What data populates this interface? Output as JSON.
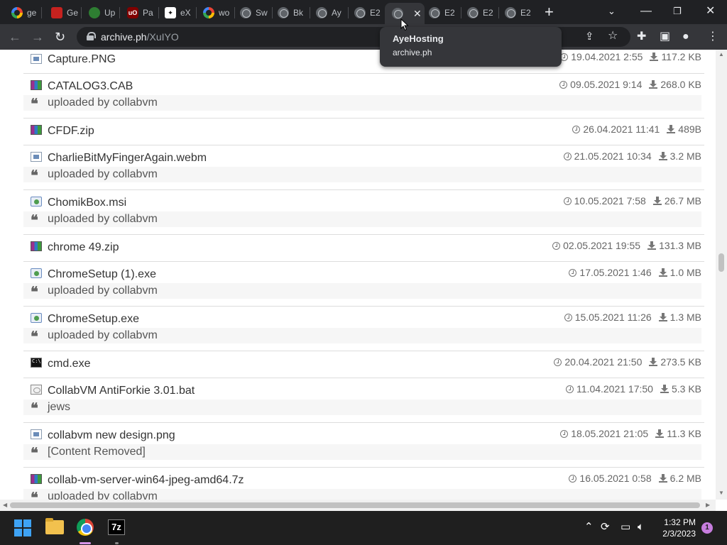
{
  "browser": {
    "tabs": [
      {
        "label": "ge",
        "icon": "google-icon"
      },
      {
        "label": "Ge",
        "icon": "red-app-icon"
      },
      {
        "label": "Up",
        "icon": "green-upload-icon"
      },
      {
        "label": "Pa",
        "icon": "ublock-icon"
      },
      {
        "label": "eX",
        "icon": "extension-icon"
      },
      {
        "label": "wo",
        "icon": "google-icon"
      },
      {
        "label": "Sw",
        "icon": "globe-icon"
      },
      {
        "label": "Bk",
        "icon": "globe-icon"
      },
      {
        "label": "Ay",
        "icon": "globe-icon"
      },
      {
        "label": "E2",
        "icon": "globe-icon"
      },
      {
        "label": "",
        "icon": "globe-icon",
        "active": true
      },
      {
        "label": "E2",
        "icon": "globe-icon"
      },
      {
        "label": "E2",
        "icon": "globe-icon"
      },
      {
        "label": "E2",
        "icon": "globe-icon"
      }
    ],
    "url_host": "archive.ph",
    "url_path": "/XuIYO",
    "tooltip": {
      "title": "AyeHosting",
      "subtitle": "archive.ph"
    }
  },
  "files": [
    {
      "name": "Capture.PNG",
      "icon": "image-file-icon",
      "date": "19.04.2021 2:55",
      "size": "117.2 KB",
      "comment": null
    },
    {
      "name": "CATALOG3.CAB",
      "icon": "archive-file-icon",
      "date": "09.05.2021 9:14",
      "size": "268.0 KB",
      "comment": "uploaded by collabvm"
    },
    {
      "name": "CFDF.zip",
      "icon": "archive-file-icon",
      "date": "26.04.2021 11:41",
      "size": "489B",
      "comment": null
    },
    {
      "name": "CharlieBitMyFingerAgain.webm",
      "icon": "video-file-icon",
      "date": "21.05.2021 10:34",
      "size": "3.2 MB",
      "comment": "uploaded by collabvm"
    },
    {
      "name": "ChomikBox.msi",
      "icon": "installer-file-icon",
      "date": "10.05.2021 7:58",
      "size": "26.7 MB",
      "comment": "uploaded by collabvm"
    },
    {
      "name": "chrome 49.zip",
      "icon": "archive-file-icon",
      "date": "02.05.2021 19:55",
      "size": "131.3 MB",
      "comment": null
    },
    {
      "name": "ChromeSetup (1).exe",
      "icon": "executable-file-icon",
      "date": "17.05.2021 1:46",
      "size": "1.0 MB",
      "comment": "uploaded by collabvm"
    },
    {
      "name": "ChromeSetup.exe",
      "icon": "executable-file-icon",
      "date": "15.05.2021 11:26",
      "size": "1.3 MB",
      "comment": "uploaded by collabvm"
    },
    {
      "name": "cmd.exe",
      "icon": "console-file-icon",
      "date": "20.04.2021 21:50",
      "size": "273.5 KB",
      "comment": null
    },
    {
      "name": "CollabVM AntiForkie 3.01.bat",
      "icon": "batch-file-icon",
      "date": "11.04.2021 17:50",
      "size": "5.3 KB",
      "comment": "jews"
    },
    {
      "name": "collabvm new design.png",
      "icon": "image-file-icon",
      "date": "18.05.2021 21:05",
      "size": "11.3 KB",
      "comment": "[Content Removed]"
    },
    {
      "name": "collab-vm-server-win64-jpeg-amd64.7z",
      "icon": "archive-file-icon",
      "date": "16.05.2021 0:58",
      "size": "6.2 MB",
      "comment": "uploaded by collabvm"
    }
  ],
  "taskbar": {
    "time": "1:32 PM",
    "date": "2/3/2023",
    "notification_count": "1",
    "sevenzip_label": "7z"
  },
  "colors": {
    "tabstrip": "#202124",
    "toolbar": "#35363a",
    "taskbar": "#1f1f1f",
    "file_text": "#333333",
    "meta_text": "#666666"
  }
}
